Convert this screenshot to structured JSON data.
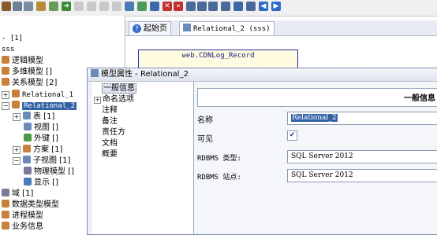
{
  "tree": {
    "root_count": "- [1]",
    "sss": "sss",
    "items": {
      "logical_model": "逻辑模型",
      "multidim_model": "多维模型 []",
      "relational_model": "关系模型 [2]",
      "relational_1": "Relational_1",
      "relational_2": "Relational_2",
      "tables": "表 [1]",
      "views": "视图 []",
      "foreign_keys": "外键 []",
      "schemas": "方案 [1]",
      "subviews": "子视图 [1]",
      "physical_models": "物理模型 []",
      "displays": "显示 []",
      "domains": "域 [1]",
      "datatype_model": "数据类型模型",
      "process_model": "进程模型",
      "business_info": "业务信息"
    }
  },
  "tabs": {
    "start_page": "起始页",
    "relational": "Relational_2 (sss)"
  },
  "entity": {
    "name": "web.CDNLog_Record"
  },
  "dialog": {
    "title": "模型属性 - Relational_2",
    "nav": [
      "一般信息",
      "命名选项",
      "注释",
      "备注",
      "责任方",
      "文档",
      "概要"
    ],
    "section_header": "一般信息",
    "fields": {
      "name_label": "名称",
      "name_value": "Relational_2",
      "visible_label": "可见",
      "rdbms_type_label": "RDBMS 类型:",
      "rdbms_type_value": "SQL Server 2012",
      "rdbms_site_label": "RDBMS 站点:",
      "rdbms_site_value": "SQL Server 2012"
    }
  }
}
